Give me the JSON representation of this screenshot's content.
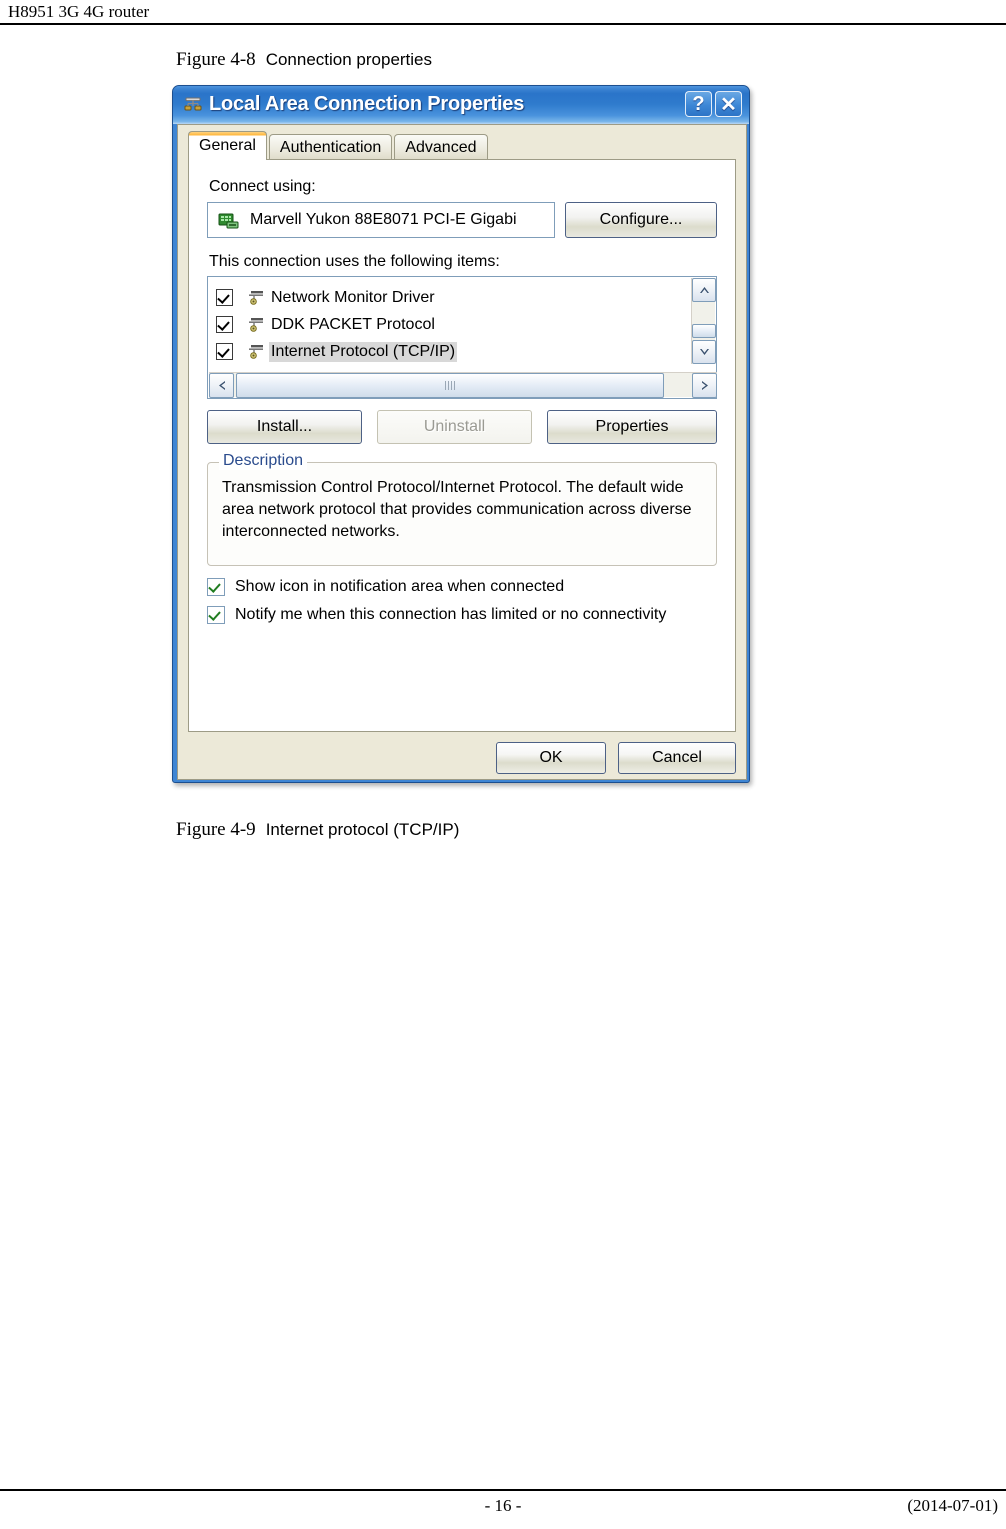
{
  "page": {
    "header_title": "H8951 3G 4G router",
    "page_number": "- 16 -",
    "date": "(2014-07-01)"
  },
  "captions": {
    "fig_48_num": "Figure 4-8",
    "fig_48_title": "Connection properties",
    "fig_49_num": "Figure 4-9",
    "fig_49_title": "Internet protocol (TCP/IP)"
  },
  "dialog": {
    "title": "Local Area Connection Properties",
    "help_button": "?",
    "close_button": "✕",
    "tabs": [
      {
        "label": "General",
        "active": true
      },
      {
        "label": "Authentication",
        "active": false
      },
      {
        "label": "Advanced",
        "active": false
      }
    ],
    "connect_using_label": "Connect using:",
    "adapter_name": "Marvell Yukon 88E8071 PCI-E Gigabi",
    "configure_button": "Configure...",
    "items_label": "This connection uses the following items:",
    "items": [
      {
        "label": "Network Monitor Driver",
        "checked": true,
        "selected": false
      },
      {
        "label": "DDK PACKET Protocol",
        "checked": true,
        "selected": false
      },
      {
        "label": "Internet Protocol (TCP/IP)",
        "checked": true,
        "selected": true
      }
    ],
    "install_button": "Install...",
    "uninstall_button": "Uninstall",
    "uninstall_disabled": true,
    "properties_button": "Properties",
    "description_legend": "Description",
    "description_text": "Transmission Control Protocol/Internet Protocol. The default wide area network protocol that provides communication across diverse interconnected networks.",
    "options": [
      {
        "label": "Show icon in notification area when connected",
        "checked": true
      },
      {
        "label": "Notify me when this connection has limited or no connectivity",
        "checked": true
      }
    ],
    "ok_button": "OK",
    "cancel_button": "Cancel"
  },
  "colors": {
    "titlebar_blue": "#2f7bcd",
    "dialog_face": "#ece9d8",
    "active_tab_accent": "#ffb83d",
    "legend_blue": "#2a4b8d",
    "check_green": "#217d21"
  }
}
